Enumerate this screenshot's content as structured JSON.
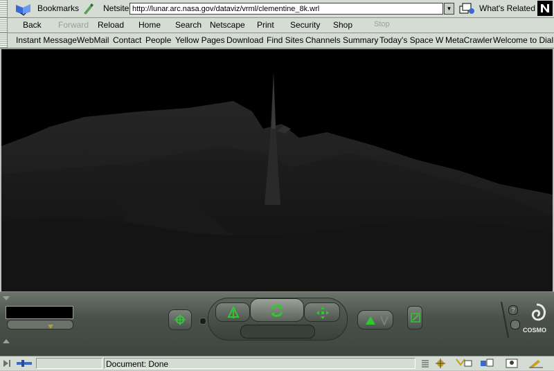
{
  "location_bar": {
    "bookmarks_label": "Bookmarks",
    "netsite_label": "Netsite:",
    "url": "http://lunar.arc.nasa.gov/dataviz/vrml/clementine_8k.wrl",
    "whats_related_label": "What's Related"
  },
  "navigation_toolbar": {
    "buttons": [
      "Back",
      "Forward",
      "Reload",
      "Home",
      "Search",
      "Netscape",
      "Print",
      "Security",
      "Shop",
      "Stop"
    ]
  },
  "personal_toolbar": {
    "links": [
      "Instant Message",
      "WebMail",
      "Contact",
      "People",
      "Yellow Pages",
      "Download",
      "Find Sites",
      "Channels",
      "Summary",
      "Today's Space W",
      "MetaCrawler",
      "Welcome to Dial"
    ]
  },
  "cosmo_player": {
    "brand": "COSMO",
    "help_label": "?"
  },
  "status_bar": {
    "status_text": "Document: Done"
  },
  "colors": {
    "chrome": "#d4dcd4",
    "viewport_background": "#000000",
    "cosmo_panel": "#4a504a",
    "accent_green": "#30c830"
  }
}
